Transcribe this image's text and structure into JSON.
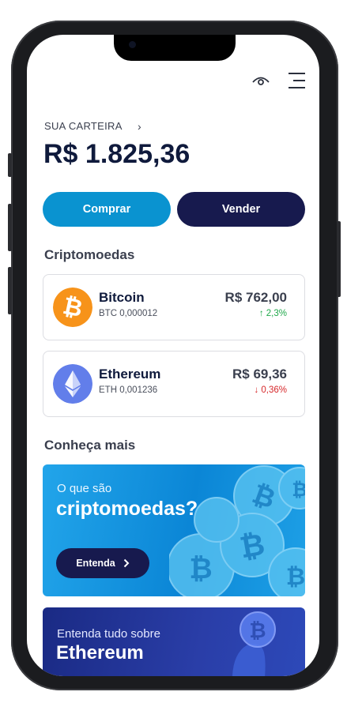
{
  "wallet": {
    "label": "SUA CARTEIRA",
    "chevron": "›",
    "balance": "R$ 1.825,36"
  },
  "actions": {
    "buy_label": "Comprar",
    "sell_label": "Vender"
  },
  "crypto_section": {
    "title": "Criptomoedas",
    "items": [
      {
        "name": "Bitcoin",
        "amount": "BTC 0,000012",
        "price": "R$ 762,00",
        "change": "↑  2,3%",
        "change_color": "#1fa84a",
        "icon": "bitcoin-icon",
        "icon_color": "#f7931a"
      },
      {
        "name": "Ethereum",
        "amount": "ETH 0,001236",
        "price": "R$ 69,36",
        "change": "↓  0,36%",
        "change_color": "#d6282b",
        "icon": "ethereum-icon",
        "icon_color": "#627eea"
      }
    ]
  },
  "learn_section": {
    "title": "Conheça mais",
    "banner1": {
      "small": "O que são",
      "big": "criptomoedas?",
      "button_label": "Entenda",
      "button_icon": "chevron-right-icon"
    },
    "banner2": {
      "small": "Entenda tudo sobre",
      "big": "Ethereum"
    }
  },
  "header": {
    "eye_icon": "eye-icon",
    "menu_icon": "menu-icon"
  },
  "colors": {
    "primary_blue": "#0a93d0",
    "navy": "#171a4e",
    "text_dark": "#0f1a3c"
  }
}
